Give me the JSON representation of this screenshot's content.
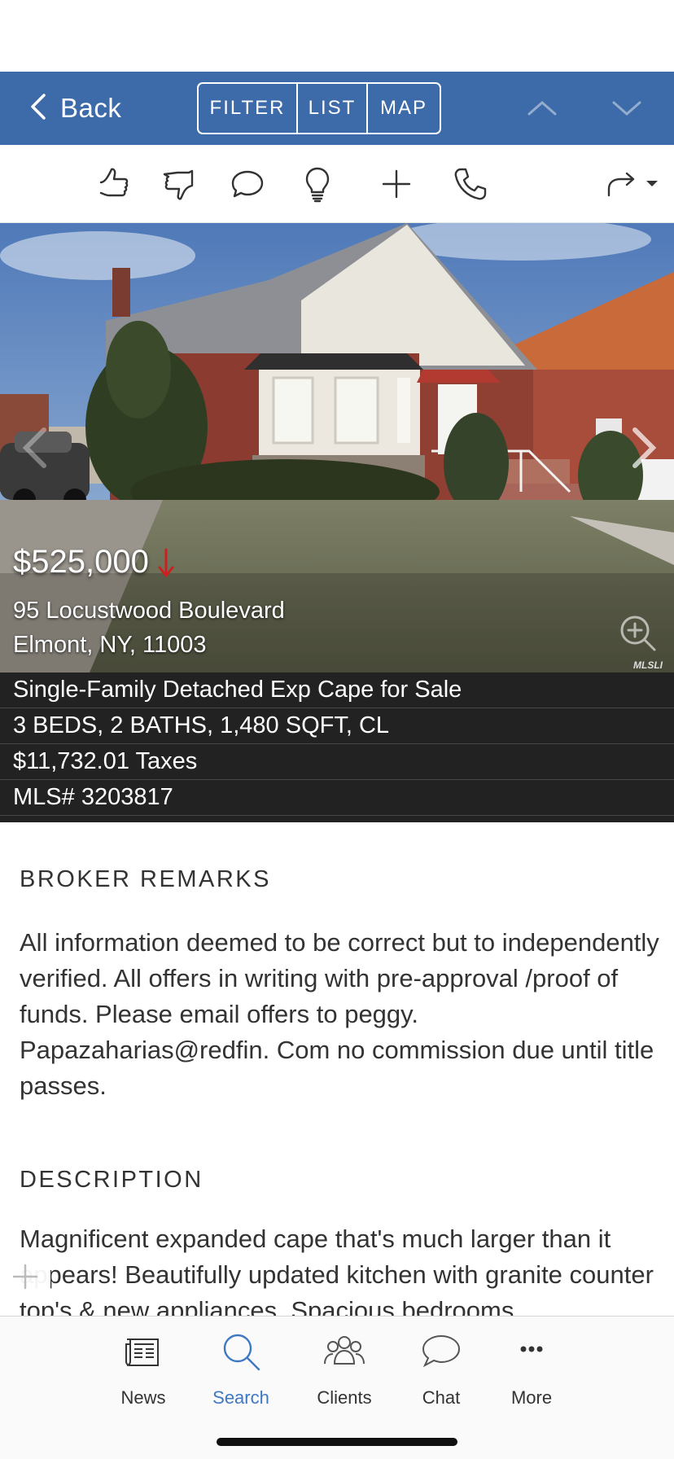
{
  "nav": {
    "back_label": "Back",
    "segments": [
      "FILTER",
      "LIST",
      "MAP"
    ],
    "accent_color": "#3d6aa8"
  },
  "actions": [
    {
      "icon": "thumbs-up-icon"
    },
    {
      "icon": "thumbs-down-icon"
    },
    {
      "icon": "comment-icon"
    },
    {
      "icon": "lightbulb-icon"
    },
    {
      "icon": "plus-icon"
    },
    {
      "icon": "phone-icon"
    },
    {
      "icon": "share-icon"
    }
  ],
  "listing": {
    "price": "$525,000",
    "price_trend": "down",
    "price_trend_color": "#cc1f1f",
    "address_line1": "95 Locustwood Boulevard",
    "address_line2": "Elmont, NY, 11003",
    "type": "Single-Family Detached Exp Cape for Sale",
    "specs": "3 BEDS, 2 BATHS, 1,480 SQFT, CL",
    "taxes": "$11,732.01 Taxes",
    "mls": "MLS# 3203817",
    "photo_badge": "MLSLI"
  },
  "broker_remarks": {
    "heading": "BROKER REMARKS",
    "text": "All information deemed to be correct but to independently verified. All offers in writing with pre-approval /proof of funds. Please email offers to peggy. Papazaharias@redfin. Com no commission due until title passes."
  },
  "description": {
    "heading": "DESCRIPTION",
    "text": "Magnificent expanded cape that's much larger than it appears! Beautifully updated kitchen with granite counter top's & new appliances. Spacious bedrooms"
  },
  "tabs": [
    {
      "label": "News",
      "icon": "newspaper-icon",
      "active": false
    },
    {
      "label": "Search",
      "icon": "search-icon",
      "active": true
    },
    {
      "label": "Clients",
      "icon": "people-icon",
      "active": false
    },
    {
      "label": "Chat",
      "icon": "chat-bubble-icon",
      "active": false
    },
    {
      "label": "More",
      "icon": "more-dots-icon",
      "active": false
    }
  ]
}
